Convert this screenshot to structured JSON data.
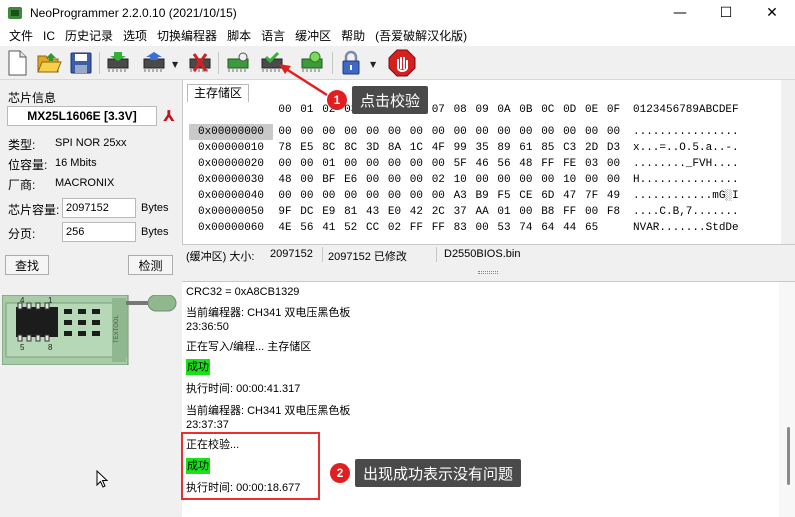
{
  "window": {
    "title": "NeoProgrammer 2.2.0.10 (2021/10/15)",
    "minimize": "—",
    "maximize": "☐",
    "close": "✕"
  },
  "menu": [
    "文件",
    "IC",
    "历史记录",
    "选项",
    "切换编程器",
    "脚本",
    "语言",
    "缓冲区",
    "帮助",
    "(吾爱破解汉化版)"
  ],
  "toolbar": {
    "icons": [
      "new-file-icon",
      "open-folder-icon",
      "save-disk-icon",
      "read-chip-icon",
      "program-chip-icon",
      "erase-chip-icon",
      "blank-check-icon",
      "verify-chip-icon",
      "auto-chip-icon",
      "lock-icon",
      "stop-icon"
    ],
    "accent": "#2e8b2e"
  },
  "chip_info": {
    "group_title": "芯片信息",
    "chip_name": "MX25L1606E [3.3V]",
    "type_label": "类型:",
    "type_value": "SPI NOR 25xx",
    "capacity_label": "位容量:",
    "capacity_value": "16 Mbits",
    "vendor_label": "厂商:",
    "vendor_value": "MACRONIX",
    "size_label": "芯片容量:",
    "size_value": "2097152",
    "size_unit": "Bytes",
    "page_label": "分页:",
    "page_value": "256",
    "page_unit": "Bytes",
    "find_button": "查找",
    "detect_button": "检测",
    "socket_text": "TEXTOOL",
    "pin_labels": [
      "4",
      "1",
      "5",
      "8"
    ]
  },
  "hex": {
    "tab_label": "主存储区",
    "columns": [
      "00",
      "01",
      "02",
      "03",
      "04",
      "05",
      "06",
      "07",
      "08",
      "09",
      "0A",
      "0B",
      "0C",
      "0D",
      "0E",
      "0F"
    ],
    "ascii_header": "0123456789ABCDEF",
    "rows": [
      {
        "addr": "0x00000000",
        "bytes": [
          "00",
          "00",
          "00",
          "00",
          "00",
          "00",
          "00",
          "00",
          "00",
          "00",
          "00",
          "00",
          "00",
          "00",
          "00",
          "00"
        ],
        "ascii": "................"
      },
      {
        "addr": "0x00000010",
        "bytes": [
          "78",
          "E5",
          "8C",
          "8C",
          "3D",
          "8A",
          "1C",
          "4F",
          "99",
          "35",
          "89",
          "61",
          "85",
          "C3",
          "2D",
          "D3"
        ],
        "ascii": "x...=..O.5.a..-."
      },
      {
        "addr": "0x00000020",
        "bytes": [
          "00",
          "00",
          "01",
          "00",
          "00",
          "00",
          "00",
          "00",
          "5F",
          "46",
          "56",
          "48",
          "FF",
          "FE",
          "03",
          "00"
        ],
        "ascii": "........_FVH...."
      },
      {
        "addr": "0x00000030",
        "bytes": [
          "48",
          "00",
          "BF",
          "E6",
          "00",
          "00",
          "00",
          "02",
          "10",
          "00",
          "00",
          "00",
          "00",
          "10",
          "00",
          "00"
        ],
        "ascii": "H..............."
      },
      {
        "addr": "0x00000040",
        "bytes": [
          "00",
          "00",
          "00",
          "00",
          "00",
          "00",
          "00",
          "00",
          "A3",
          "B9",
          "F5",
          "CE",
          "6D",
          "47",
          "7F",
          "49"
        ],
        "ascii": "............mG░I"
      },
      {
        "addr": "0x00000050",
        "bytes": [
          "9F",
          "DC",
          "E9",
          "81",
          "43",
          "E0",
          "42",
          "2C",
          "37",
          "AA",
          "01",
          "00",
          "B8",
          "FF",
          "00",
          "F8"
        ],
        "ascii": "....C.B,7......."
      },
      {
        "addr": "0x00000060",
        "bytes": [
          "4E",
          "56",
          "41",
          "52",
          "CC",
          "02",
          "FF",
          "FF",
          "83",
          "00",
          "53",
          "74",
          "64",
          "44",
          "65"
        ],
        "ascii": "NVAR.......StdDe"
      }
    ]
  },
  "status": {
    "buffer_label": "(缓冲区) 大小:",
    "size": "2097152",
    "modified": "2097152 已修改",
    "file": "D2550BIOS.bin"
  },
  "log": {
    "lines": [
      {
        "text": "CRC32 = 0xA8CB1329",
        "ok": false
      },
      {
        "text": "当前编程器: CH341 双电压黑色板",
        "ok": false
      },
      {
        "text": "23:36:50",
        "ok": false
      },
      {
        "text": "正在写入/编程... 主存储区",
        "ok": false
      },
      {
        "text": "成功",
        "ok": true
      },
      {
        "text": "执行时间:  00:00:41.317",
        "ok": false
      },
      {
        "text": "当前编程器: CH341 双电压黑色板",
        "ok": false
      },
      {
        "text": "23:37:37",
        "ok": false
      },
      {
        "text": "正在校验...",
        "ok": false
      },
      {
        "text": "成功",
        "ok": true
      },
      {
        "text": "执行时间:  00:00:18.677",
        "ok": false
      }
    ],
    "success_color": "#17e317"
  },
  "annotations": {
    "badge1": "1",
    "callout1": "点击校验",
    "badge2": "2",
    "callout2": "出现成功表示没有问题",
    "highlight_color": "#e83030"
  }
}
